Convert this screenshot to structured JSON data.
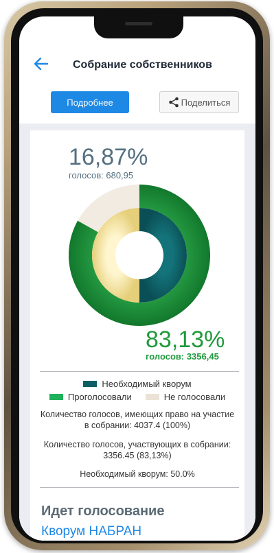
{
  "header": {
    "title": "Собрание собственников"
  },
  "actions": {
    "details_label": "Подробнее",
    "share_label": "Поделиться"
  },
  "summary": {
    "not_voted": {
      "percent_text": "16,87%",
      "votes_text": "голосов: 680,95"
    },
    "voted": {
      "percent_text": "83,13%",
      "votes_text": "голосов: 3356,45"
    }
  },
  "colors": {
    "accent": "#1e88e5",
    "voted": "#1f8f3a",
    "not_voted": "#ece3d6",
    "quorum_required": "#0d5e64",
    "inner_ring": "#f2e4a0",
    "status_text": "#5a6a75"
  },
  "chart_data": {
    "type": "pie",
    "rings": [
      {
        "ring": "outer",
        "slices": [
          {
            "label": "Проголосовали",
            "value": 83.13
          },
          {
            "label": "Не голосовали",
            "value": 16.87
          }
        ]
      },
      {
        "ring": "inner",
        "slices": [
          {
            "label": "Необходимый кворум",
            "value": 50.0
          },
          {
            "label": "",
            "value": 50.0
          }
        ]
      }
    ],
    "legend_position": "bottom"
  },
  "legend": {
    "quorum": "Необходимый кворум",
    "voted": "Проголосовали",
    "not_voted": "Не голосовали"
  },
  "info": {
    "eligible_votes": "Количество голосов, имеющих право на участие в собрании: 4037.4  (100%)",
    "participating_votes": "Количество голосов, участвующих в собрании: 3356.45  (83,13%)",
    "required_quorum": "Необходимый кворум: 50.0%"
  },
  "status": {
    "voting": "Идет голосование",
    "quorum": "Кворум НАБРАН"
  }
}
